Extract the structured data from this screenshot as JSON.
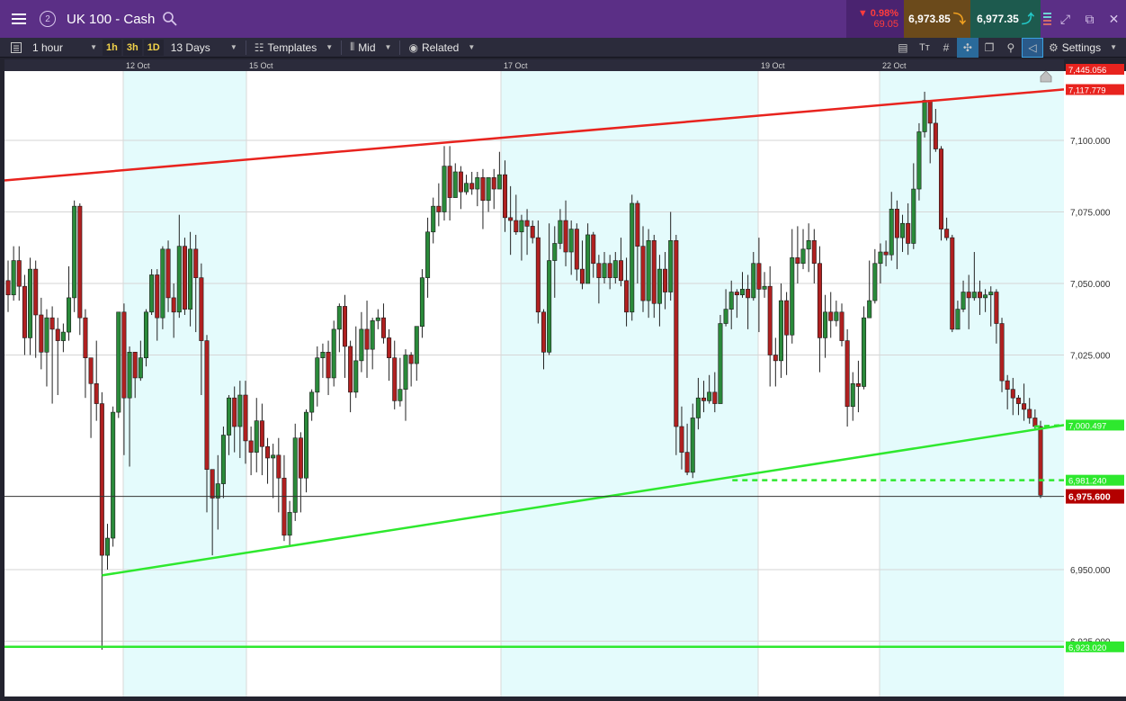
{
  "window": {
    "title": "UK 100 - Cash",
    "link_number": "2",
    "change_pct": "▼ 0.98%",
    "change_abs": "69.05",
    "sell_price": "6,973.85",
    "buy_price": "6,977.35"
  },
  "toolbar": {
    "interval": "1 hour",
    "quick_1h": "1h",
    "quick_3h": "3h",
    "quick_1d": "1D",
    "range": "13 Days",
    "templates": "Templates",
    "price_type": "Mid",
    "related": "Related",
    "settings": "Settings"
  },
  "colors": {
    "bull": "#2a8a3a",
    "bear": "#b02020",
    "resistance": "#e8231e",
    "support": "#2ee82e",
    "session_shade": "#e4fbfc",
    "last_price_tag": "#b30000"
  },
  "chart_data": {
    "type": "candlestick",
    "instrument": "UK 100 - Cash",
    "interval": "1 hour",
    "x_tick_labels": [
      "12 Oct",
      "15 Oct",
      "17 Oct",
      "19 Oct",
      "22 Oct"
    ],
    "ylim": [
      6920,
      7123
    ],
    "y_tick_labels": [
      {
        "value": 7100,
        "label": "7,100.000"
      },
      {
        "value": 7075,
        "label": "7,075.000"
      },
      {
        "value": 7050,
        "label": "7,050.000"
      },
      {
        "value": 7025,
        "label": "7,025.000"
      },
      {
        "value": 6950,
        "label": "6,950.000"
      },
      {
        "value": 6925,
        "label": "6,925.000"
      }
    ],
    "price_tags": [
      {
        "value": 7445.056,
        "label": "7,445.056",
        "kind": "resistance-top"
      },
      {
        "value": 7117.779,
        "label": "7,117.779",
        "kind": "resistance"
      },
      {
        "value": 7000.497,
        "label": "7,000.497",
        "kind": "support"
      },
      {
        "value": 6981.24,
        "label": "6,981.240",
        "kind": "support"
      },
      {
        "value": 6975.6,
        "label": "6,975.600",
        "kind": "last"
      },
      {
        "value": 6923.02,
        "label": "6,923.020",
        "kind": "support"
      }
    ],
    "trendlines": [
      {
        "name": "",
        "kind": "resistance",
        "from": [
          0,
          7086
        ],
        "to": [
          1,
          7117.8
        ]
      },
      {
        "name": "",
        "kind": "support",
        "from": [
          0.092,
          6948
        ],
        "to": [
          1,
          7000.5
        ]
      },
      {
        "name": "",
        "kind": "support",
        "from": [
          0,
          6923.02
        ],
        "to": [
          1,
          6923.02
        ]
      },
      {
        "name": "",
        "kind": "support-dashed",
        "from": [
          0.687,
          6981.24
        ],
        "to": [
          1,
          6981.24
        ]
      }
    ],
    "last_price": 6975.6,
    "candles": [
      [
        7051,
        7046,
        7058,
        7040
      ],
      [
        7046,
        7058,
        7063,
        7044
      ],
      [
        7058,
        7049,
        7063,
        7044
      ],
      [
        7049,
        7031,
        7053,
        7025
      ],
      [
        7031,
        7055,
        7059,
        7025
      ],
      [
        7055,
        7039,
        7058,
        7024
      ],
      [
        7039,
        7026,
        7045,
        7020
      ],
      [
        7026,
        7038,
        7041,
        7014
      ],
      [
        7038,
        7034,
        7042,
        7008
      ],
      [
        7034,
        7030,
        7038,
        7011
      ],
      [
        7030,
        7033,
        7036,
        7026
      ],
      [
        7033,
        7045,
        7056,
        7030
      ],
      [
        7045,
        7077,
        7079,
        7040
      ],
      [
        7077,
        7038,
        7078,
        7032
      ],
      [
        7038,
        7024,
        7041,
        7010
      ],
      [
        7024,
        7015,
        7023,
        6996
      ],
      [
        7015,
        7008,
        7030,
        7002
      ],
      [
        7008,
        6955,
        7012,
        6922
      ],
      [
        6955,
        6961,
        6966,
        6950
      ],
      [
        6961,
        7005,
        7007,
        6958
      ],
      [
        7005,
        7040,
        7040,
        7003
      ],
      [
        7040,
        7010,
        7043,
        6990
      ],
      [
        7010,
        7026,
        7028,
        6986
      ],
      [
        7026,
        7017,
        7025,
        7010
      ],
      [
        7017,
        7024,
        7030,
        7016
      ],
      [
        7024,
        7040,
        7041,
        7021
      ],
      [
        7040,
        7053,
        7055,
        7039
      ],
      [
        7053,
        7038,
        7055,
        7030
      ],
      [
        7038,
        7062,
        7063,
        7034
      ],
      [
        7062,
        7045,
        7065,
        7040
      ],
      [
        7045,
        7040,
        7050,
        7031
      ],
      [
        7040,
        7063,
        7074,
        7038
      ],
      [
        7063,
        7041,
        7066,
        7039
      ],
      [
        7041,
        7062,
        7068,
        7035
      ],
      [
        7062,
        7052,
        7067,
        7033
      ],
      [
        7052,
        7030,
        7057,
        7011
      ],
      [
        7030,
        6985,
        7032,
        6970
      ],
      [
        6985,
        6975,
        6983,
        6955
      ],
      [
        6975,
        6980,
        6990,
        6964
      ],
      [
        6980,
        6997,
        7000,
        6975
      ],
      [
        6997,
        7010,
        7011,
        6990
      ],
      [
        7010,
        7000,
        7014,
        6991
      ],
      [
        7000,
        7011,
        7016,
        6989
      ],
      [
        7011,
        6995,
        7016,
        6987
      ],
      [
        6995,
        6991,
        7000,
        6983
      ],
      [
        6991,
        7002,
        7010,
        6984
      ],
      [
        7002,
        6993,
        7008,
        6983
      ],
      [
        6993,
        6989,
        6996,
        6980
      ],
      [
        6989,
        6990,
        6994,
        6975
      ],
      [
        6990,
        6982,
        6996,
        6970
      ],
      [
        6982,
        6962,
        6990,
        6960
      ],
      [
        6962,
        6970,
        6974,
        6958
      ],
      [
        6970,
        6996,
        7001,
        6967
      ],
      [
        6996,
        6982,
        6998,
        6970
      ],
      [
        6982,
        7005,
        7006,
        6977
      ],
      [
        7005,
        7012,
        7013,
        7002
      ],
      [
        7012,
        7024,
        7028,
        7007
      ],
      [
        7024,
        7026,
        7029,
        7017
      ],
      [
        7026,
        7017,
        7030,
        7011
      ],
      [
        7017,
        7034,
        7037,
        7014
      ],
      [
        7034,
        7042,
        7043,
        7026
      ],
      [
        7042,
        7028,
        7046,
        7017
      ],
      [
        7028,
        7012,
        7030,
        7005
      ],
      [
        7012,
        7023,
        7035,
        7010
      ],
      [
        7023,
        7034,
        7040,
        7019
      ],
      [
        7034,
        7027,
        7044,
        7017
      ],
      [
        7027,
        7037,
        7038,
        7020
      ],
      [
        7037,
        7038,
        7041,
        7034
      ],
      [
        7038,
        7031,
        7043,
        7029
      ],
      [
        7031,
        7024,
        7034,
        7016
      ],
      [
        7024,
        7009,
        7030,
        7006
      ],
      [
        7009,
        7013,
        7024,
        7007
      ],
      [
        7013,
        7025,
        7027,
        7002
      ],
      [
        7025,
        7022,
        7026,
        7014
      ],
      [
        7022,
        7035,
        7035,
        7016
      ],
      [
        7035,
        7052,
        7055,
        7031
      ],
      [
        7052,
        7068,
        7073,
        7045
      ],
      [
        7068,
        7077,
        7080,
        7064
      ],
      [
        7077,
        7075,
        7085,
        7070
      ],
      [
        7075,
        7091,
        7098,
        7072
      ],
      [
        7091,
        7080,
        7098,
        7072
      ],
      [
        7080,
        7089,
        7092,
        7080
      ],
      [
        7089,
        7082,
        7091,
        7076
      ],
      [
        7082,
        7085,
        7088,
        7081
      ],
      [
        7085,
        7083,
        7089,
        7081
      ],
      [
        7083,
        7087,
        7089,
        7077
      ],
      [
        7087,
        7079,
        7090,
        7069
      ],
      [
        7079,
        7087,
        7087,
        7075
      ],
      [
        7087,
        7083,
        7090,
        7076
      ],
      [
        7083,
        7088,
        7096,
        7084
      ],
      [
        7088,
        7073,
        7093,
        7068
      ],
      [
        7073,
        7072,
        7084,
        7060
      ],
      [
        7072,
        7068,
        7081,
        7067
      ],
      [
        7068,
        7072,
        7074,
        7058
      ],
      [
        7072,
        7070,
        7076,
        7060
      ],
      [
        7070,
        7066,
        7072,
        7064
      ],
      [
        7066,
        7040,
        7072,
        7036
      ],
      [
        7040,
        7026,
        7041,
        7020
      ],
      [
        7026,
        7058,
        7071,
        7025
      ],
      [
        7058,
        7064,
        7070,
        7045
      ],
      [
        7064,
        7072,
        7076,
        7062
      ],
      [
        7072,
        7061,
        7079,
        7056
      ],
      [
        7061,
        7069,
        7072,
        7053
      ],
      [
        7069,
        7055,
        7071,
        7051
      ],
      [
        7055,
        7050,
        7065,
        7048
      ],
      [
        7050,
        7067,
        7071,
        7050
      ],
      [
        7067,
        7057,
        7068,
        7052
      ],
      [
        7057,
        7052,
        7060,
        7043
      ],
      [
        7052,
        7057,
        7061,
        7050
      ],
      [
        7057,
        7052,
        7060,
        7048
      ],
      [
        7052,
        7058,
        7061,
        7050
      ],
      [
        7058,
        7051,
        7066,
        7049
      ],
      [
        7051,
        7040,
        7059,
        7035
      ],
      [
        7040,
        7078,
        7081,
        7037
      ],
      [
        7078,
        7063,
        7079,
        7050
      ],
      [
        7063,
        7044,
        7070,
        7040
      ],
      [
        7044,
        7065,
        7069,
        7038
      ],
      [
        7065,
        7043,
        7067,
        7038
      ],
      [
        7043,
        7055,
        7060,
        7035
      ],
      [
        7055,
        7047,
        7061,
        7041
      ],
      [
        7047,
        7065,
        7075,
        7044
      ],
      [
        7065,
        7000,
        7067,
        6990
      ],
      [
        7000,
        6991,
        7007,
        6985
      ],
      [
        6991,
        6984,
        7001,
        6983
      ],
      [
        6984,
        7003,
        7008,
        6982
      ],
      [
        7003,
        7010,
        7017,
        6999
      ],
      [
        7010,
        7009,
        7016,
        7005
      ],
      [
        7009,
        7012,
        7018,
        7008
      ],
      [
        7012,
        7008,
        7019,
        7005
      ],
      [
        7008,
        7036,
        7039,
        7008
      ],
      [
        7036,
        7041,
        7048,
        7035
      ],
      [
        7041,
        7047,
        7051,
        7034
      ],
      [
        7047,
        7046,
        7048,
        7038
      ],
      [
        7046,
        7048,
        7054,
        7045
      ],
      [
        7048,
        7045,
        7053,
        7034
      ],
      [
        7045,
        7057,
        7061,
        7044
      ],
      [
        7057,
        7048,
        7066,
        7033
      ],
      [
        7048,
        7049,
        7054,
        7045
      ],
      [
        7049,
        7025,
        7056,
        7014
      ],
      [
        7025,
        7023,
        7031,
        7014
      ],
      [
        7023,
        7044,
        7050,
        7017
      ],
      [
        7044,
        7032,
        7047,
        7018
      ],
      [
        7032,
        7059,
        7069,
        7029
      ],
      [
        7059,
        7057,
        7070,
        7050
      ],
      [
        7057,
        7062,
        7069,
        7055
      ],
      [
        7062,
        7065,
        7071,
        7054
      ],
      [
        7065,
        7057,
        7069,
        7050
      ],
      [
        7057,
        7031,
        7063,
        7019
      ],
      [
        7031,
        7040,
        7046,
        7024
      ],
      [
        7040,
        7037,
        7047,
        7031
      ],
      [
        7037,
        7040,
        7044,
        7035
      ],
      [
        7040,
        7030,
        7043,
        7028
      ],
      [
        7030,
        7007,
        7034,
        7000
      ],
      [
        7007,
        7015,
        7019,
        7002
      ],
      [
        7015,
        7014,
        7023,
        7005
      ],
      [
        7014,
        7038,
        7042,
        7013
      ],
      [
        7038,
        7044,
        7058,
        7038
      ],
      [
        7044,
        7057,
        7062,
        7043
      ],
      [
        7057,
        7061,
        7064,
        7050
      ],
      [
        7061,
        7060,
        7065,
        7056
      ],
      [
        7060,
        7076,
        7082,
        7058
      ],
      [
        7076,
        7066,
        7079,
        7055
      ],
      [
        7066,
        7071,
        7074,
        7061
      ],
      [
        7071,
        7064,
        7078,
        7060
      ],
      [
        7064,
        7083,
        7092,
        7062
      ],
      [
        7083,
        7103,
        7106,
        7079
      ],
      [
        7103,
        7114,
        7117,
        7101
      ],
      [
        7114,
        7106,
        7114,
        7092
      ],
      [
        7106,
        7097,
        7111,
        7096
      ],
      [
        7097,
        7069,
        7098,
        7065
      ],
      [
        7069,
        7066,
        7073,
        7065
      ],
      [
        7066,
        7034,
        7067,
        7033
      ],
      [
        7034,
        7041,
        7044,
        7036
      ],
      [
        7041,
        7047,
        7051,
        7040
      ],
      [
        7047,
        7045,
        7053,
        7034
      ],
      [
        7045,
        7047,
        7061,
        7044
      ],
      [
        7047,
        7045,
        7051,
        7039
      ],
      [
        7045,
        7046,
        7048,
        7040
      ],
      [
        7046,
        7047,
        7049,
        7035
      ],
      [
        7047,
        7036,
        7048,
        7029
      ],
      [
        7036,
        7016,
        7038,
        7012
      ],
      [
        7016,
        7013,
        7018,
        7006
      ],
      [
        7013,
        7010,
        7017,
        7004
      ],
      [
        7010,
        7008,
        7011,
        7004
      ],
      [
        7008,
        7006,
        7015,
        7002
      ],
      [
        7006,
        7003,
        7010,
        7001
      ],
      [
        7003,
        7000,
        7006,
        6999
      ],
      [
        7000,
        6976,
        7002,
        6975
      ]
    ]
  }
}
